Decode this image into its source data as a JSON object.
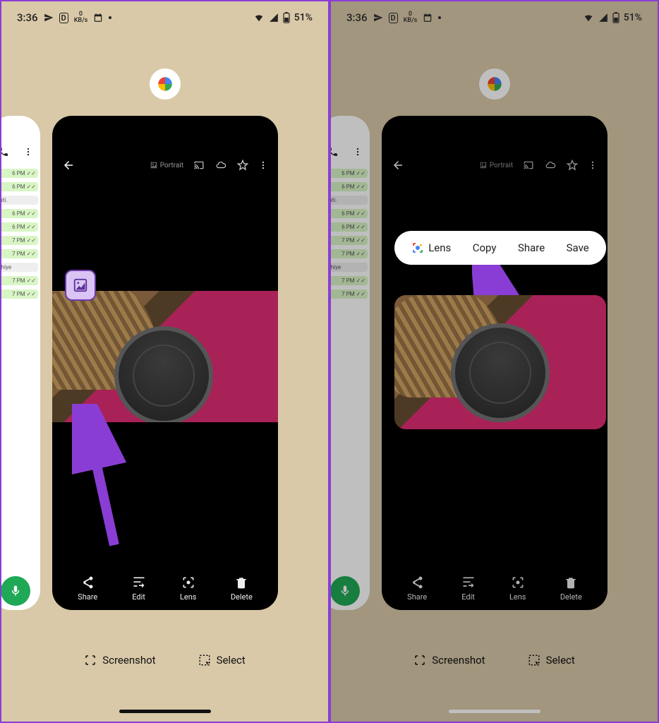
{
  "status": {
    "time": "3:36",
    "net": "0",
    "netUnit": "KB/s",
    "battery": "51%"
  },
  "app": {
    "portrait_label": "Portrait"
  },
  "photo_actions": {
    "share": "Share",
    "edit": "Edit",
    "lens": "Lens",
    "delete": "Delete"
  },
  "recents": {
    "screenshot": "Screenshot",
    "select": "Select"
  },
  "popup": {
    "lens": "Lens",
    "copy": "Copy",
    "share": "Share",
    "save": "Save"
  },
  "chat": {
    "items": [
      "6 PM ✓✓",
      "6 PM ✓✓",
      "ulati.",
      "6 PM ✓✓",
      "6 PM ✓✓",
      "7 PM ✓✓",
      "7 PM ✓✓",
      "hahiye",
      "7 PM ✓✓",
      "7 PM ✓✓"
    ]
  }
}
